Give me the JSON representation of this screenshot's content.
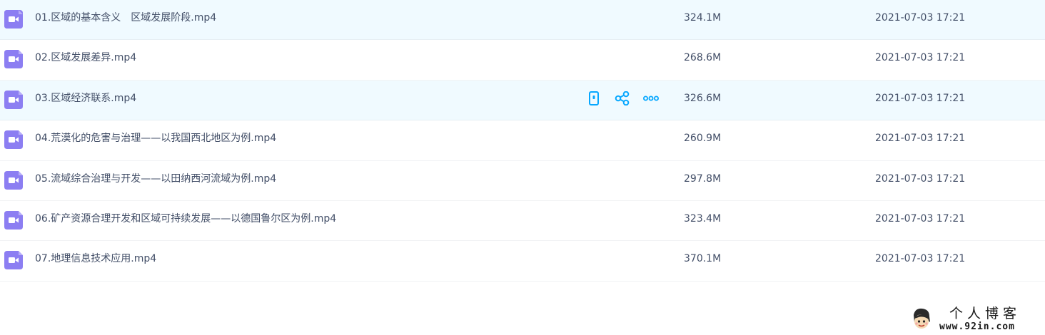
{
  "files": [
    {
      "name": "01.区域的基本含义　区域发展阶段.mp4",
      "size": "324.1M",
      "date": "2021-07-03 17:21"
    },
    {
      "name": "02.区域发展差异.mp4",
      "size": "268.6M",
      "date": "2021-07-03 17:21"
    },
    {
      "name": "03.区域经济联系.mp4",
      "size": "326.6M",
      "date": "2021-07-03 17:21"
    },
    {
      "name": "04.荒漠化的危害与治理——以我国西北地区为例.mp4",
      "size": "260.9M",
      "date": "2021-07-03 17:21"
    },
    {
      "name": "05.流域综合治理与开发——以田纳西河流域为例.mp4",
      "size": "297.8M",
      "date": "2021-07-03 17:21"
    },
    {
      "name": "06.矿产资源合理开发和区域可持续发展——以德国鲁尔区为例.mp4",
      "size": "323.4M",
      "date": "2021-07-03 17:21"
    },
    {
      "name": "07.地理信息技术应用.mp4",
      "size": "370.1M",
      "date": "2021-07-03 17:21"
    }
  ],
  "icons": {
    "file": "video-file-icon",
    "actions": [
      "phone-icon",
      "share-icon",
      "more-icon"
    ]
  },
  "colors": {
    "video_icon": "#8c7ef2",
    "action_icon": "#06a7ff",
    "highlight_row": "#f0faff",
    "text": "#424e67"
  },
  "watermark": {
    "title": "个人博客",
    "url": "www.92in.com"
  }
}
